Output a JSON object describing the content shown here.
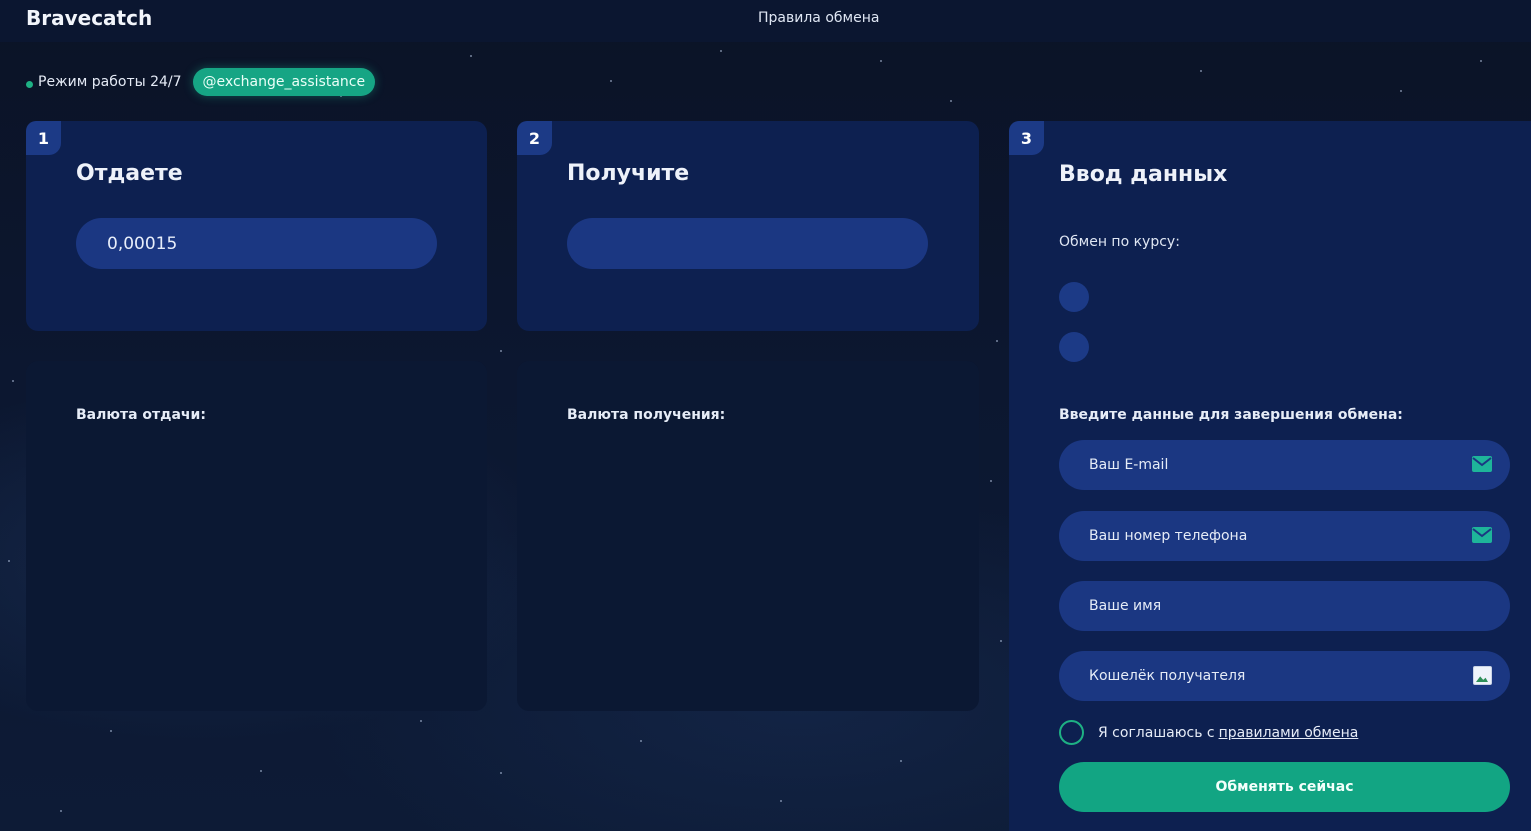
{
  "header": {
    "brand": "Bravecatch",
    "rules_link": "Правила обмена"
  },
  "status": {
    "text": "Режим работы 24/7",
    "telegram": "@exchange_assistance"
  },
  "give": {
    "step": "1",
    "title": "Отдаете",
    "amount": "0,00015",
    "currency_label": "Валюта отдачи:"
  },
  "receive": {
    "step": "2",
    "title": "Получите",
    "amount": "",
    "currency_label": "Валюта получения:"
  },
  "form": {
    "step": "3",
    "title": "Ввод данных",
    "rate_label": "Обмен по курсу:",
    "enter_label": "Введите данные для завершения обмена:",
    "email_placeholder": "Ваш E-mail",
    "phone_placeholder": "Ваш номер телефона",
    "name_placeholder": "Ваше имя",
    "wallet_placeholder": "Кошелёк получателя",
    "agree_text": "Я соглашаюсь с",
    "agree_link": "правилами обмена",
    "submit_label": "Обменять сейчас"
  },
  "icons": {
    "email": "envelope-icon",
    "phone": "envelope-icon",
    "wallet": "broken-image-icon"
  },
  "colors": {
    "accent": "#16a584",
    "card": "#0d2050",
    "field": "#1b3782"
  }
}
